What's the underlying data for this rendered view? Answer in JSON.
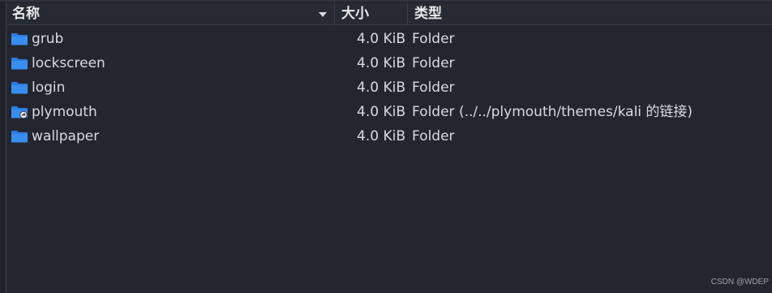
{
  "columns": {
    "name": "名称",
    "size": "大小",
    "type": "类型"
  },
  "files": [
    {
      "name": "grub",
      "size": "4.0 KiB",
      "type": "Folder",
      "icon": "folder-icon"
    },
    {
      "name": "lockscreen",
      "size": "4.0 KiB",
      "type": "Folder",
      "icon": "folder-icon"
    },
    {
      "name": "login",
      "size": "4.0 KiB",
      "type": "Folder",
      "icon": "folder-icon"
    },
    {
      "name": "plymouth",
      "size": "4.0 KiB",
      "type": "Folder (../../plymouth/themes/kali 的链接)",
      "icon": "folder-link-icon"
    },
    {
      "name": "wallpaper",
      "size": "4.0 KiB",
      "type": "Folder",
      "icon": "folder-icon"
    }
  ],
  "watermark": "CSDN @WDEP",
  "colors": {
    "background": "#23262f",
    "folder": "#2f7de1",
    "text": "#d9dbe0"
  }
}
